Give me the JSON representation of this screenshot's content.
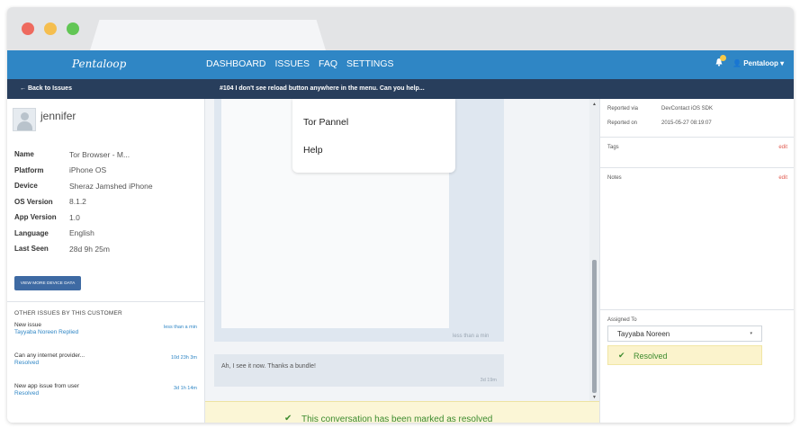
{
  "nav": {
    "brand": "Pentaloop",
    "menu": [
      "DASHBOARD",
      "ISSUES",
      "FAQ",
      "SETTINGS"
    ],
    "user": "Pentaloop",
    "user_caret": "▾",
    "bell_icon": "bell-icon",
    "user_icon": "user-icon"
  },
  "subbar": {
    "back": "← Back to Issues",
    "issue_title": "#104 I don't see reload button anywhere in the menu. Can you help..."
  },
  "customer": {
    "name": "jennifer",
    "props": [
      {
        "k": "Name",
        "v": "Tor Browser - M..."
      },
      {
        "k": "Platform",
        "v": "iPhone OS"
      },
      {
        "k": "Device",
        "v": "Sheraz Jamshed iPhone"
      },
      {
        "k": "OS Version",
        "v": "8.1.2"
      },
      {
        "k": "App Version",
        "v": "1.0"
      },
      {
        "k": "Language",
        "v": "English"
      },
      {
        "k": "Last Seen",
        "v": "28d 9h 25m"
      }
    ],
    "device_button": "VIEW MORE DEVICE DATA",
    "other_title": "OTHER ISSUES BY THIS CUSTOMER",
    "other_issues": [
      {
        "title": "New issue",
        "sub": "Tayyaba Noreen Replied",
        "time": "less than a min"
      },
      {
        "title": "Can any internet provider...",
        "sub": "Resolved",
        "time": "10d 23h 3m"
      },
      {
        "title": "New app issue from user",
        "sub": "Resolved",
        "time": "3d 1h 14m"
      }
    ]
  },
  "conversation": {
    "menu_items": [
      "Tor Pannel",
      "Help"
    ],
    "image_time": "less than a min",
    "message": "Ah, I see it now. Thanks a bundle!",
    "message_time": "3d 19m",
    "resolved_banner": "This conversation has been marked as resolved",
    "scroll_up": "▲",
    "scroll_down": "▼",
    "check": "✔"
  },
  "details": {
    "reported_via_label": "Reported via",
    "reported_via": "DevContact iOS SDK",
    "reported_on_label": "Reported on",
    "reported_on": "2015-05-27 08:19:07",
    "tags_label": "Tags",
    "notes_label": "Notes",
    "edit": "edit",
    "assigned_label": "Assigned To",
    "assignee": "Tayyaba Noreen",
    "assignee_caret": "▾",
    "status": "Resolved",
    "check": "✔"
  },
  "colors": {
    "nav": "#2f86c5",
    "subbar": "#283e5c",
    "resolved_green": "#3c8b2e",
    "edit_red": "#e05a4f"
  }
}
